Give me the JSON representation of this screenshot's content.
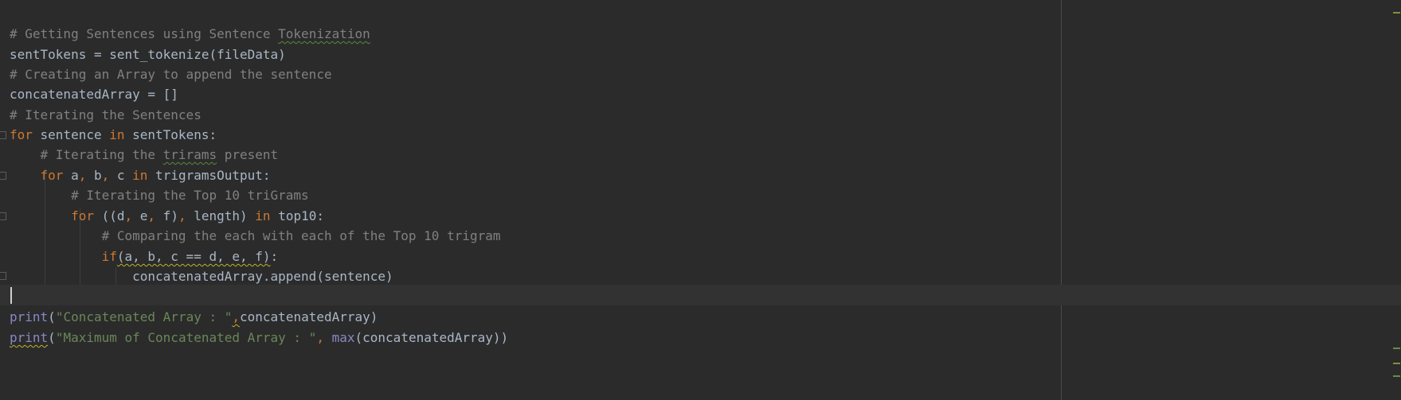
{
  "editor": {
    "colors": {
      "background": "#2b2b2b",
      "comment": "#808080",
      "keyword": "#cc7832",
      "identifier": "#a9b7c6",
      "builtin": "#8888c6",
      "string": "#6a8759"
    },
    "lines": {
      "l1": {
        "comment_prefix": "# Getting Sentences using Sentence ",
        "comment_typo": "Tokenization"
      },
      "l2": {
        "text": "sentTokens = sent_tokenize(fileData)"
      },
      "l3": {
        "comment": "# Creating an Array to append the sentence"
      },
      "l4": {
        "text": "concatenatedArray = []"
      },
      "l5": {
        "comment": "# Iterating the Sentences"
      },
      "l6": {
        "kw_for": "for",
        "var": " sentence ",
        "kw_in": "in",
        "rest": " sentTokens:"
      },
      "l7": {
        "indent": "    ",
        "comment_prefix": "# Iterating the ",
        "comment_typo": "trirams",
        "comment_suffix": " present"
      },
      "l8": {
        "indent": "    ",
        "kw_for": "for",
        "a": " a",
        "c1": ",",
        "b": " b",
        "c2": ",",
        "c": " c ",
        "kw_in": "in",
        "rest": " trigramsOutput:"
      },
      "l9": {
        "indent": "        ",
        "comment": "# Iterating the Top 10 triGrams"
      },
      "l10": {
        "indent": "        ",
        "kw_for": "for",
        "open": " ((d",
        "c1": ",",
        "e": " e",
        "c2": ",",
        "f": " f)",
        "c3": ",",
        "length": " length) ",
        "kw_in": "in",
        "rest": " top10:"
      },
      "l11": {
        "indent": "            ",
        "comment": "# Comparing the each with each of the Top 10 trigram"
      },
      "l12": {
        "indent": "            ",
        "kw_if": "if",
        "cond": "(a, b, c == d, e, f)",
        "colon": ":"
      },
      "l13": {
        "indent": "                ",
        "text": "concatenatedArray.append(sentence)"
      },
      "l15": {
        "fn": "print",
        "open": "(",
        "str": "\"Concatenated Array : \"",
        "comma": ",",
        "rest": "concatenatedArray)"
      },
      "l16": {
        "fn": "print",
        "open": "(",
        "str": "\"Maximum of Concatenated Array : \"",
        "comma": ",",
        "space": " ",
        "fn2": "max",
        "rest": "(concatenatedArray))"
      }
    }
  }
}
